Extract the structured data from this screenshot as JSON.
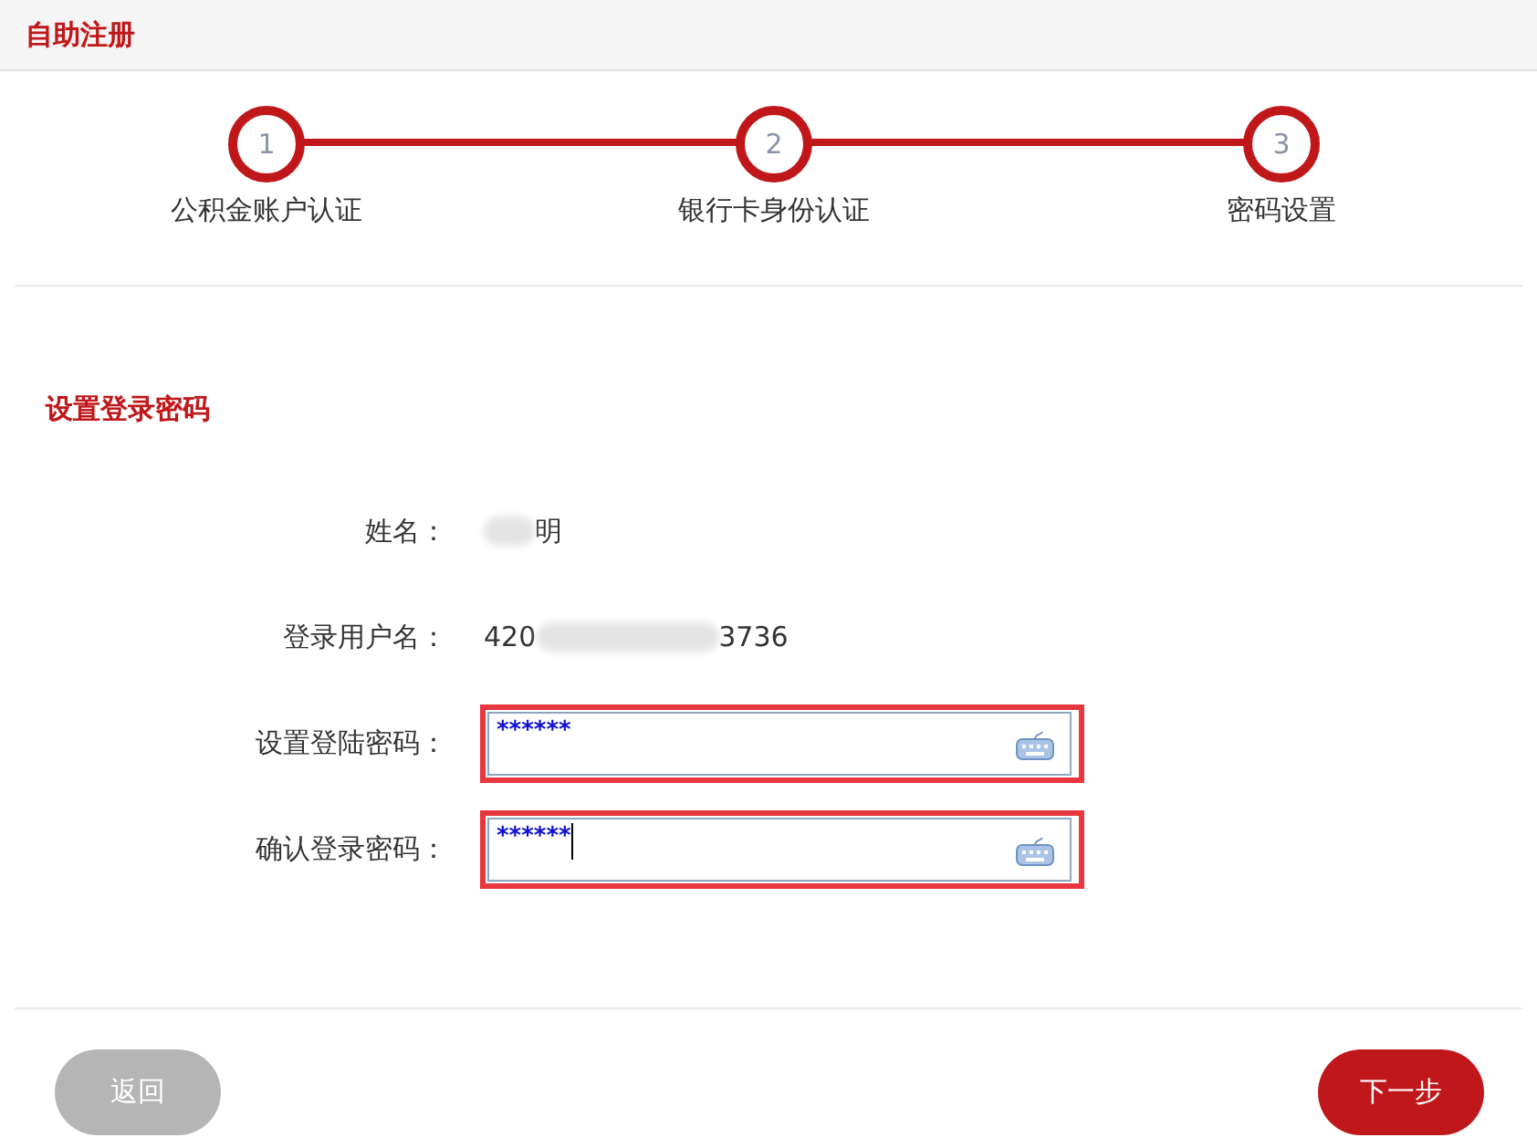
{
  "header": {
    "title": "自助注册"
  },
  "steps": [
    {
      "number": "1",
      "label": "公积金账户认证",
      "done": true
    },
    {
      "number": "2",
      "label": "银行卡身份认证",
      "done": true
    },
    {
      "number": "3",
      "label": "密码设置",
      "done": true
    }
  ],
  "section_title": "设置登录密码",
  "fields": [
    {
      "kind": "text",
      "label": "姓名：",
      "value_end": "明",
      "redacted": true
    },
    {
      "kind": "text",
      "label": "登录用户名：",
      "value_start": "420",
      "value_end": "3736",
      "redacted": true
    },
    {
      "kind": "password",
      "label": "设置登陆密码：",
      "value": "******",
      "highlighted": true
    },
    {
      "kind": "password",
      "label": "确认登录密码：",
      "value": "******",
      "highlighted": true,
      "focused": true
    }
  ],
  "buttons": [
    {
      "label": "返回",
      "disabled": true
    },
    {
      "label": "下一步",
      "disabled": false
    }
  ]
}
